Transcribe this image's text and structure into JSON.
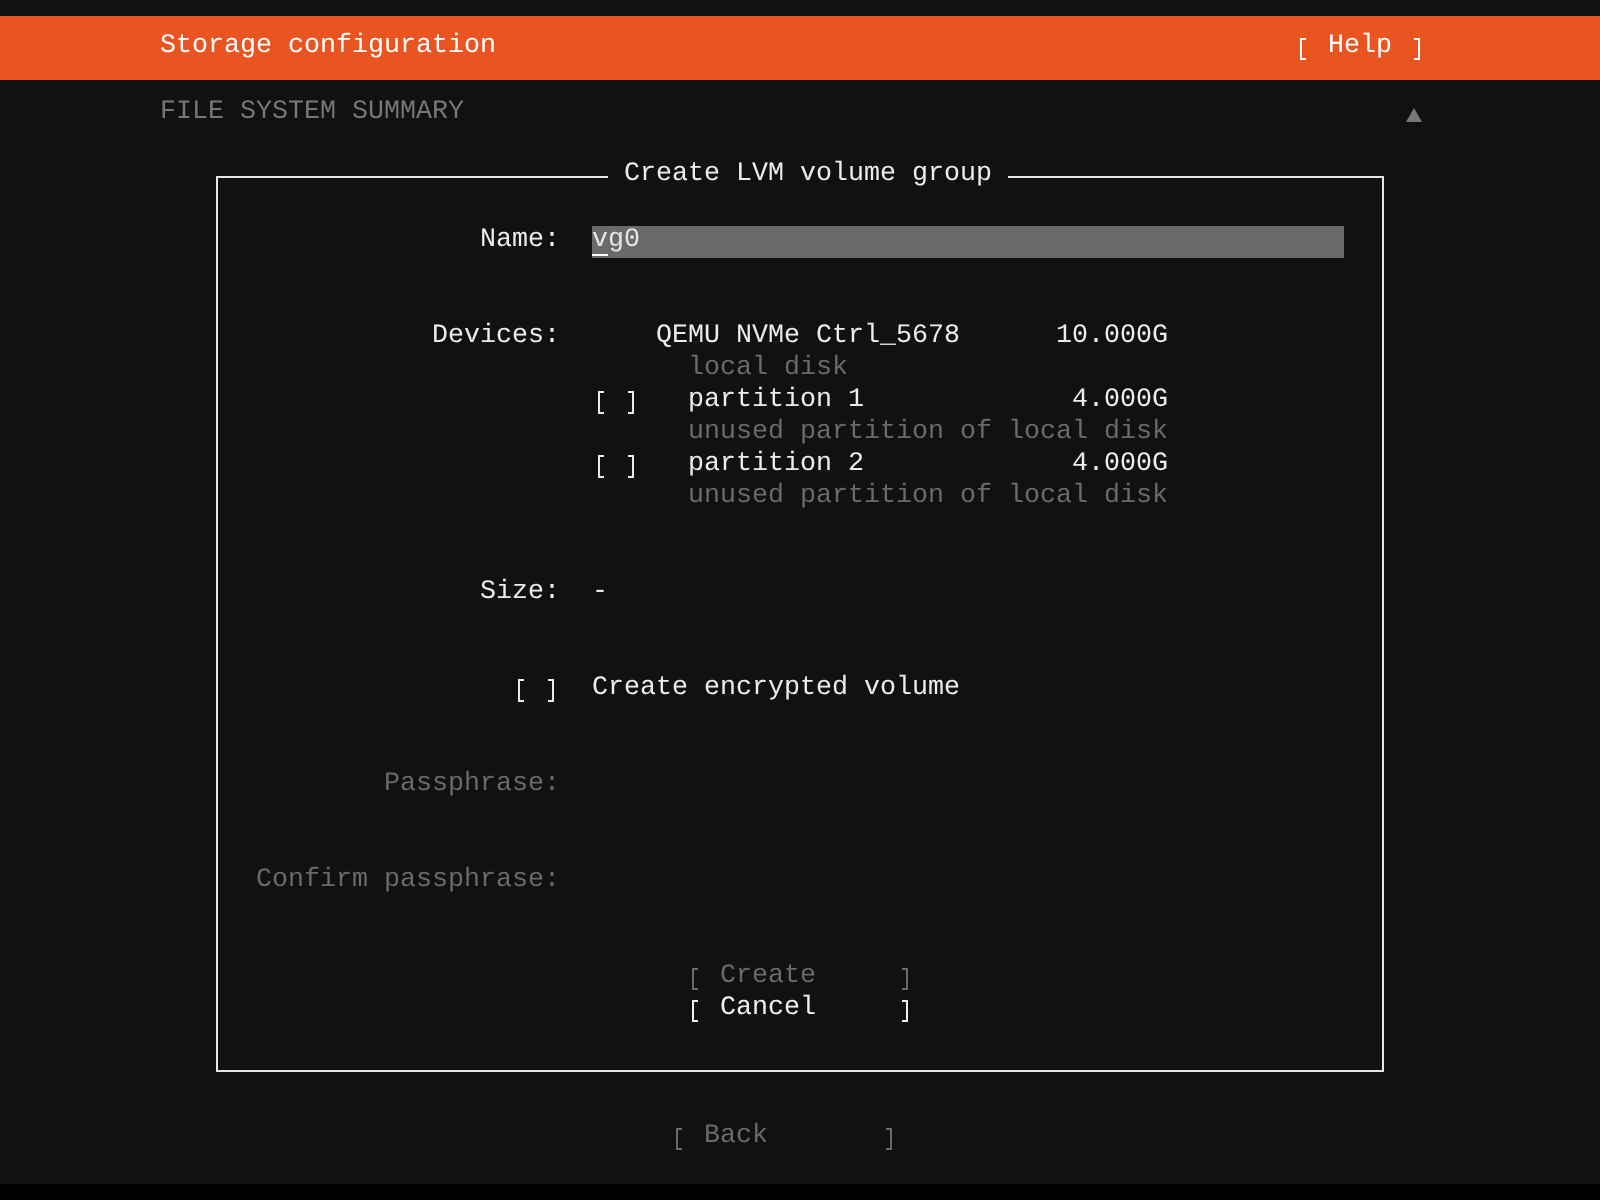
{
  "header": {
    "title": "Storage configuration",
    "help_button": {
      "label": "Help"
    }
  },
  "summary": {
    "heading": "FILE SYSTEM SUMMARY"
  },
  "dialog": {
    "title": "Create LVM volume group",
    "name_field": {
      "label": "Name:",
      "value": "vg0",
      "focused": true
    },
    "devices": {
      "label": "Devices:",
      "items": [
        {
          "name": "QEMU NVMe Ctrl_5678",
          "size": "10.000G",
          "description": "local disk",
          "children": [
            {
              "name": "partition 1",
              "size": "4.000G",
              "description": "unused partition of local disk",
              "checked": false
            },
            {
              "name": "partition 2",
              "size": "4.000G",
              "description": "unused partition of local disk",
              "checked": false
            }
          ]
        }
      ]
    },
    "size": {
      "label": "Size:",
      "value": "-"
    },
    "encrypt": {
      "label": "Create encrypted volume",
      "checked": false
    },
    "passphrase_fields": [
      {
        "label": "Passphrase:",
        "disabled": true
      },
      {
        "label": "Confirm passphrase:",
        "disabled": true
      }
    ],
    "buttons": [
      {
        "label": "Create",
        "disabled": true
      },
      {
        "label": "Cancel",
        "disabled": false
      }
    ]
  },
  "footer": {
    "buttons": [
      {
        "label": "Back",
        "disabled": true
      }
    ]
  }
}
